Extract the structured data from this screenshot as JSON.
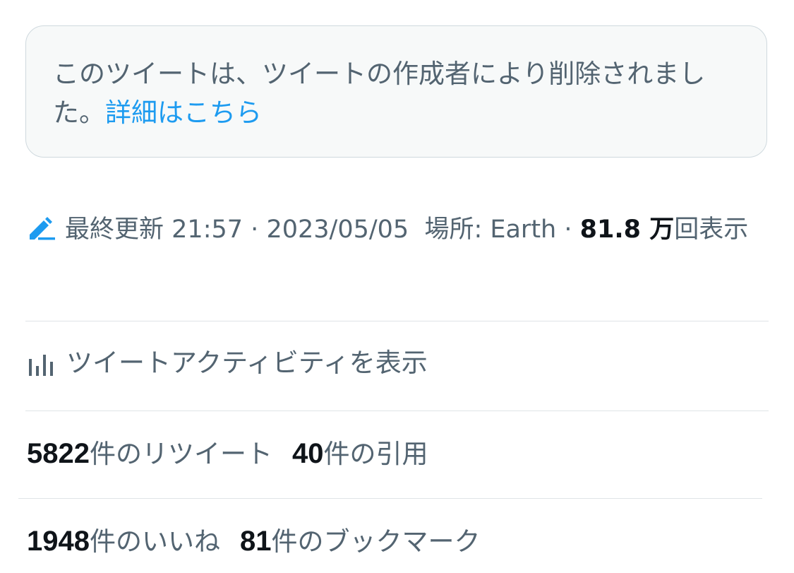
{
  "deleted_notice": {
    "text": "このツイートは、ツイートの作成者により削除されました。",
    "link_label": "詳細はこちら"
  },
  "meta": {
    "edit_icon": "pencil-icon",
    "last_updated_label": "最終更新",
    "time": "21:57",
    "separator": "·",
    "date": "2023/05/05",
    "location_label": "場所: Earth",
    "views_count": "81.8 万",
    "views_label": "回表示"
  },
  "activity": {
    "icon": "bar-chart-icon",
    "label": "ツイートアクティビティを表示"
  },
  "stats": {
    "retweets_count": "5822",
    "retweets_label": "件のリツイート",
    "quotes_count": "40",
    "quotes_label": "件の引用",
    "likes_count": "1948",
    "likes_label": "件のいいね",
    "bookmarks_count": "81",
    "bookmarks_label": "件のブックマーク"
  },
  "colors": {
    "link": "#1d9bf0",
    "secondary_text": "#536471",
    "primary_text": "#0f1419",
    "box_background": "#f7f9f9",
    "border": "#cfd9de"
  }
}
